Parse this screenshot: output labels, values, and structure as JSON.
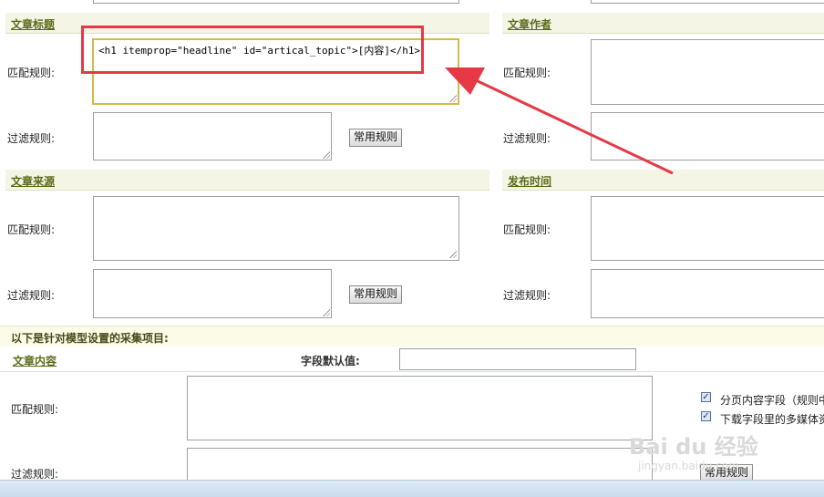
{
  "sections": {
    "title": "文章标题",
    "author": "文章作者",
    "source": "文章来源",
    "pubtime": "发布时间",
    "content": "文章内容"
  },
  "labels": {
    "match": "匹配规则:",
    "filter": "过滤规则:"
  },
  "buttons": {
    "common_rules": "常用规则"
  },
  "fields": {
    "title_match_value": "<h1 itemprop=\"headline\" id=\"artical_topic\">[内容]</h1>",
    "default_value_label": "字段默认值:"
  },
  "model_section": {
    "heading": "以下是针对模型设置的采集项目:"
  },
  "options": {
    "paged_content": "分页内容字段（规则中",
    "download_media": "下载字段里的多媒体资"
  },
  "watermark": {
    "logo": "Bai du 经验",
    "url": "jingyan.baidu.com"
  },
  "colors": {
    "section_bg": "#f4f5e4",
    "section_text": "#5a6b1a",
    "annotation": "#e63946",
    "focus_border": "#d7b84a"
  }
}
